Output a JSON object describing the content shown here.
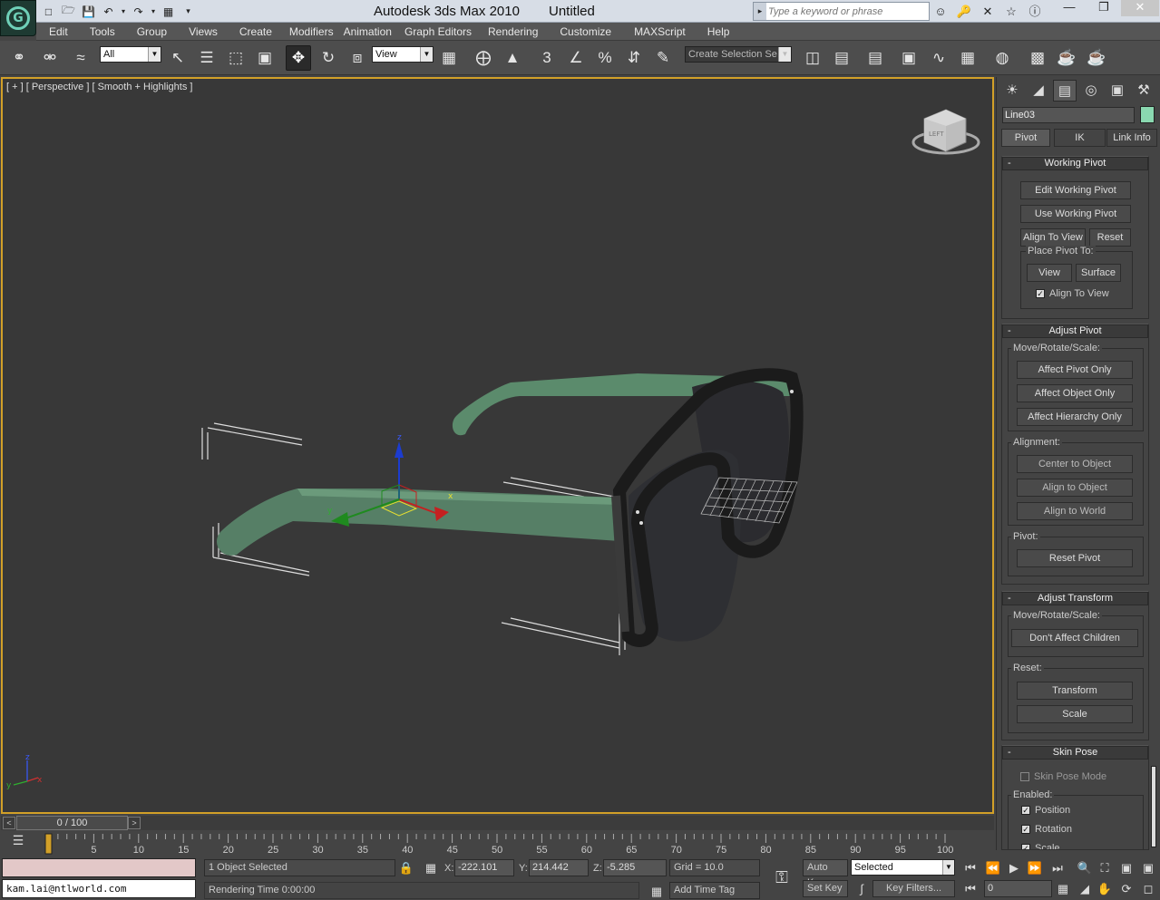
{
  "title_bar": {
    "app_title": "Autodesk 3ds Max  2010",
    "doc_title": "Untitled",
    "search_placeholder": "Type a keyword or phrase"
  },
  "menu": [
    "Edit",
    "Tools",
    "Group",
    "Views",
    "Create",
    "Modifiers",
    "Animation",
    "Graph Editors",
    "Rendering",
    "Customize",
    "MAXScript",
    "Help"
  ],
  "toolbar": {
    "selection_filter": "All",
    "reference_coord": "View",
    "named_selection": "Create Selection Se"
  },
  "viewport": {
    "label": "[ + ] [ Perspective ] [ Smooth + Highlights ]",
    "viewcube_face": "LEFT"
  },
  "command_panel": {
    "object_name": "Line03",
    "object_color": "#8ad8b0",
    "subtabs": [
      "Pivot",
      "IK",
      "Link Info"
    ],
    "working_pivot": {
      "title": "Working Pivot",
      "edit_working_pivot": "Edit Working Pivot",
      "use_working_pivot": "Use Working Pivot",
      "align_to_view": "Align To View",
      "reset": "Reset",
      "place_pivot_to": "Place Pivot To:",
      "view": "View",
      "surface": "Surface",
      "align_to_view_check": "Align To View"
    },
    "adjust_pivot": {
      "title": "Adjust Pivot",
      "move_rotate_scale": "Move/Rotate/Scale:",
      "affect_pivot_only": "Affect Pivot Only",
      "affect_object_only": "Affect Object Only",
      "affect_hierarchy_only": "Affect Hierarchy Only",
      "alignment": "Alignment:",
      "center_to_object": "Center to Object",
      "align_to_object": "Align to Object",
      "align_to_world": "Align to World",
      "pivot": "Pivot:",
      "reset_pivot": "Reset Pivot"
    },
    "adjust_transform": {
      "title": "Adjust Transform",
      "move_rotate_scale": "Move/Rotate/Scale:",
      "dont_affect_children": "Don't Affect Children",
      "reset": "Reset:",
      "transform": "Transform",
      "scale": "Scale"
    },
    "skin_pose": {
      "title": "Skin Pose",
      "skin_pose_mode": "Skin Pose Mode",
      "enabled": "Enabled:",
      "position": "Position",
      "rotation": "Rotation",
      "scale": "Scale"
    }
  },
  "timeline": {
    "frame_display": "0 / 100",
    "ticks": [
      "5",
      "10",
      "15",
      "20",
      "25",
      "30",
      "35",
      "40",
      "45",
      "50",
      "55",
      "60",
      "65",
      "70",
      "75",
      "80",
      "85",
      "90",
      "95",
      "100"
    ]
  },
  "status": {
    "maxscript_output": "kam.lai@ntlworld.com",
    "selection_status": "1 Object Selected",
    "prompt": "Rendering Time  0:00:00",
    "x_label": "X:",
    "x_value": "-222.101",
    "y_label": "Y:",
    "y_value": "214.442",
    "z_label": "Z:",
    "z_value": "-5.285",
    "grid": "Grid = 10.0",
    "add_time_tag": "Add Time Tag",
    "auto_key": "Auto Key",
    "set_key": "Set Key",
    "key_mode": "Selected",
    "key_filters": "Key Filters...",
    "current_frame": "0"
  }
}
